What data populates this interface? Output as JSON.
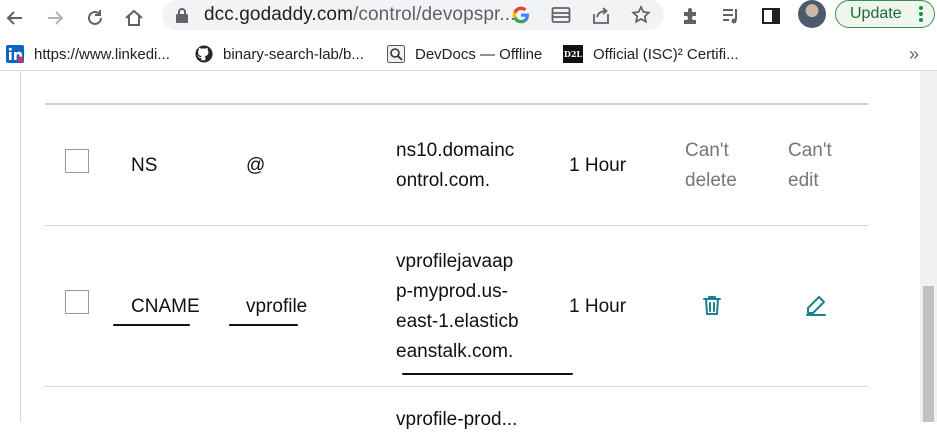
{
  "browser": {
    "url_host": "dcc.godaddy.com",
    "url_path": "/control/devopspr...",
    "update_label": "Update"
  },
  "bookmarks": [
    {
      "label": "https://www.linkedi...",
      "icon": "linkedin-icon"
    },
    {
      "label": "binary-search-lab/b...",
      "icon": "github-icon"
    },
    {
      "label": "DevDocs — Offline",
      "icon": "devdocs-icon"
    },
    {
      "label": "Official (ISC)² Certifi...",
      "icon": "d2l-icon"
    }
  ],
  "bookmarks_overflow": "»",
  "d2l_icon_text": "D2L",
  "records": [
    {
      "type": "NS",
      "name": "@",
      "value_lines": [
        "ns10.domainc",
        "ontrol.com."
      ],
      "ttl": "1 Hour",
      "delete_text": [
        "Can't",
        "delete"
      ],
      "edit_text": [
        "Can't",
        "edit"
      ]
    },
    {
      "type": "CNAME",
      "name": "vprofile",
      "value_lines": [
        "vprofilejavaap",
        "p-myprod.us-",
        "east-1.elasticb",
        "eanstalk.com."
      ],
      "ttl": "1 Hour",
      "delete_icon": "trash-icon",
      "edit_icon": "pencil-icon"
    }
  ],
  "partial_row_text": "vprofile-prod...",
  "colors": {
    "action_icon": "#1a7f8e",
    "update_border": "#3c8d4f"
  }
}
